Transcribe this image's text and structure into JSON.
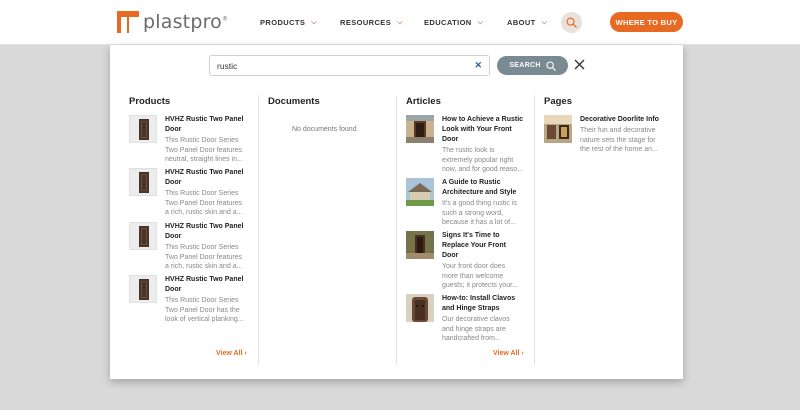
{
  "header": {
    "logo_text": "plastpro",
    "logo_mark": "®",
    "nav": [
      {
        "label": "PRODUCTS"
      },
      {
        "label": "RESOURCES"
      },
      {
        "label": "EDUCATION"
      },
      {
        "label": "ABOUT"
      }
    ],
    "where_to_buy": "WHERE TO BUY"
  },
  "search": {
    "value": "rustic",
    "submit_label": "SEARCH"
  },
  "columns": {
    "products": {
      "title": "Products",
      "items": [
        {
          "title_l1": "HVHZ Rustic Two Panel",
          "title_l2": "Door",
          "desc": [
            "This Rustic Door Series",
            "Two Panel Door features",
            "neutral, straight lines in..."
          ]
        },
        {
          "title_l1": "HVHZ Rustic Two Panel",
          "title_l2": "Door",
          "desc": [
            "This Rustic Door Series",
            "Two Panel Door features",
            "a rich, rustic skin and a..."
          ]
        },
        {
          "title_l1": "HVHZ Rustic Two Panel",
          "title_l2": "Door",
          "desc": [
            "This Rustic Door Series",
            "Two Panel Door features",
            "a rich, rustic skin and a..."
          ]
        },
        {
          "title_l1": "HVHZ Rustic Two Panel",
          "title_l2": "Door",
          "desc": [
            "This Rustic Door Series",
            "Two Panel Door has the",
            "look of vertical planking..."
          ]
        }
      ],
      "view_all": "View All ›"
    },
    "documents": {
      "title": "Documents",
      "empty": "No documents found"
    },
    "articles": {
      "title": "Articles",
      "items": [
        {
          "title": [
            "How to Achieve a Rustic",
            "Look with Your Front",
            "Door"
          ],
          "desc": [
            "The rustic look is",
            "extremely popular right",
            "now, and for good reaso..."
          ]
        },
        {
          "title": [
            "A Guide to Rustic",
            "Architecture and Style"
          ],
          "desc": [
            "It's a good thing rustic is",
            "such a strong word,",
            "because it has a lot of..."
          ]
        },
        {
          "title": [
            "Signs It's Time to",
            "Replace Your Front",
            "Door"
          ],
          "desc": [
            "Your front door does",
            "more than welcome",
            "guests; it protects your..."
          ]
        },
        {
          "title": [
            "How-to: Install Clavos",
            "and Hinge Straps"
          ],
          "desc": [
            "Our decorative clavos",
            "and hinge straps are",
            "handcrafted from..."
          ]
        }
      ],
      "view_all": "View All ›"
    },
    "pages": {
      "title": "Pages",
      "items": [
        {
          "title": "Decorative Doorlite Info",
          "desc": [
            "Their fun and decorative",
            "nature sets the stage for",
            "the rest of the home an..."
          ]
        }
      ]
    }
  },
  "colors": {
    "accent": "#e86a22",
    "search_button": "#7a8a93",
    "background": "#d9d9d9"
  }
}
